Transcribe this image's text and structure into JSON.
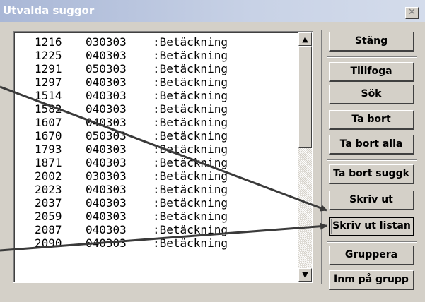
{
  "window": {
    "title": "Utvalda suggor",
    "close_glyph": "✕",
    "close_icon": "close-icon"
  },
  "list": {
    "rows": [
      {
        "num": "1216",
        "date": "030303",
        "event": ":Betäckning"
      },
      {
        "num": "1225",
        "date": "040303",
        "event": ":Betäckning"
      },
      {
        "num": "1291",
        "date": "050303",
        "event": ":Betäckning"
      },
      {
        "num": "1297",
        "date": "040303",
        "event": ":Betäckning"
      },
      {
        "num": "1514",
        "date": "040303",
        "event": ":Betäckning"
      },
      {
        "num": "1582",
        "date": "040303",
        "event": ":Betäckning"
      },
      {
        "num": "1607",
        "date": "040303",
        "event": ":Betäckning"
      },
      {
        "num": "1670",
        "date": "050303",
        "event": ":Betäckning"
      },
      {
        "num": "1793",
        "date": "040303",
        "event": ":Betäckning"
      },
      {
        "num": "1871",
        "date": "040303",
        "event": ":Betäckning"
      },
      {
        "num": "2002",
        "date": "030303",
        "event": ":Betäckning"
      },
      {
        "num": "2023",
        "date": "040303",
        "event": ":Betäckning"
      },
      {
        "num": "2037",
        "date": "040303",
        "event": ":Betäckning"
      },
      {
        "num": "2059",
        "date": "040303",
        "event": ":Betäckning"
      },
      {
        "num": "2087",
        "date": "040303",
        "event": ":Betäckning"
      },
      {
        "num": "2090",
        "date": "040303",
        "event": ":Betäckning"
      }
    ],
    "scroll_up_glyph": "▲",
    "scroll_down_glyph": "▼"
  },
  "buttons": {
    "close": "Stäng",
    "append": "Tillfoga",
    "search": "Sök",
    "delete": "Ta bort",
    "delete_all": "Ta bort alla",
    "delete_sow_card": "Ta bort suggk",
    "print": "Skriv ut",
    "print_list": "Skriv ut listan",
    "group": "Gruppera",
    "report_group": "Inm på grupp"
  },
  "colors": {
    "title_gradient_start": "#a9b7d6",
    "window_face": "#d4d0c8",
    "arrow": "#3a3a3a"
  }
}
